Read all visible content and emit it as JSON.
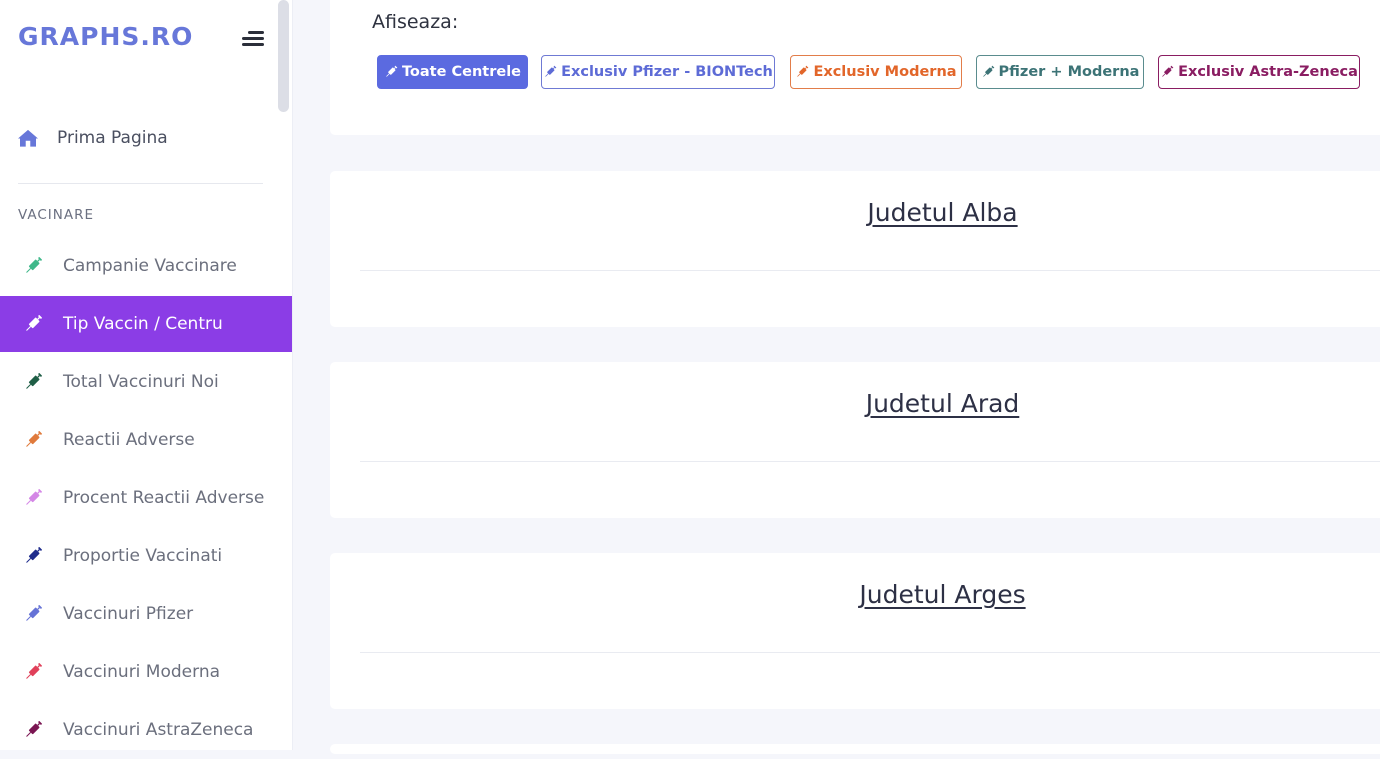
{
  "brand": "GRAPHS.RO",
  "sidebar": {
    "home_label": "Prima Pagina",
    "section_title": "VACINARE",
    "items": [
      {
        "label": "Campanie Vaccinare",
        "icon": "syringe-icon",
        "color": "#3fb88a",
        "active": false
      },
      {
        "label": "Tip Vaccin / Centru",
        "icon": "syringe-icon",
        "color": "#ffffff",
        "active": true
      },
      {
        "label": "Total Vaccinuri Noi",
        "icon": "syringe-icon",
        "color": "#1f5e46",
        "active": false
      },
      {
        "label": "Reactii Adverse",
        "icon": "syringe-icon",
        "color": "#e07a3c",
        "active": false
      },
      {
        "label": "Procent Reactii Adverse",
        "icon": "syringe-icon",
        "color": "#d487e6",
        "active": false
      },
      {
        "label": "Proportie Vaccinati",
        "icon": "syringe-icon",
        "color": "#1f2c8c",
        "active": false
      },
      {
        "label": "Vaccinuri Pfizer",
        "icon": "syringe-icon",
        "color": "#6673d6",
        "active": false
      },
      {
        "label": "Vaccinuri Moderna",
        "icon": "syringe-icon",
        "color": "#e0405a",
        "active": false
      },
      {
        "label": "Vaccinuri AstraZeneca",
        "icon": "syringe-icon",
        "color": "#7a1552",
        "active": false
      }
    ]
  },
  "filter": {
    "title": "Afiseaza:",
    "buttons": [
      {
        "label": "Toate Centrele",
        "color": "#ffffff"
      },
      {
        "label": "Exclusiv Pfizer - BIONTech",
        "color": "#5d6bd6"
      },
      {
        "label": "Exclusiv Moderna",
        "color": "#e2662a"
      },
      {
        "label": "Pfizer + Moderna",
        "color": "#3c7376"
      },
      {
        "label": "Exclusiv Astra-Zeneca",
        "color": "#8a1d62"
      }
    ]
  },
  "counties": [
    "Judetul Alba",
    "Judetul Arad",
    "Judetul Arges"
  ]
}
